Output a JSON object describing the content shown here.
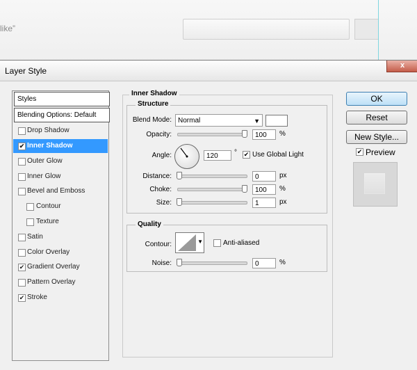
{
  "background_page": {
    "text": "like”"
  },
  "dialog": {
    "title": "Layer Style",
    "close_label": "x"
  },
  "styles_list": {
    "header": "Styles",
    "blending": "Blending Options: Default",
    "items": [
      {
        "label": "Drop Shadow",
        "checked": false
      },
      {
        "label": "Inner Shadow",
        "checked": true
      },
      {
        "label": "Outer Glow",
        "checked": false
      },
      {
        "label": "Inner Glow",
        "checked": false
      },
      {
        "label": "Bevel and Emboss",
        "checked": false
      },
      {
        "label": "Contour",
        "checked": false
      },
      {
        "label": "Texture",
        "checked": false
      },
      {
        "label": "Satin",
        "checked": false
      },
      {
        "label": "Color Overlay",
        "checked": false
      },
      {
        "label": "Gradient Overlay",
        "checked": true
      },
      {
        "label": "Pattern Overlay",
        "checked": false
      },
      {
        "label": "Stroke",
        "checked": true
      }
    ],
    "selected": "Inner Shadow"
  },
  "inner_shadow": {
    "title": "Inner Shadow",
    "structure": {
      "title": "Structure",
      "blend_mode_label": "Blend Mode:",
      "blend_mode_value": "Normal",
      "opacity_label": "Opacity:",
      "opacity_value": "100",
      "opacity_unit": "%",
      "angle_label": "Angle:",
      "angle_value": "120",
      "angle_unit": "°",
      "use_global_light_label": "Use Global Light",
      "use_global_light": true,
      "distance_label": "Distance:",
      "distance_value": "0",
      "distance_unit": "px",
      "choke_label": "Choke:",
      "choke_value": "100",
      "choke_unit": "%",
      "size_label": "Size:",
      "size_value": "1",
      "size_unit": "px"
    },
    "quality": {
      "title": "Quality",
      "contour_label": "Contour:",
      "anti_aliased_label": "Anti-aliased",
      "anti_aliased": false,
      "noise_label": "Noise:",
      "noise_value": "0",
      "noise_unit": "%"
    }
  },
  "buttons": {
    "ok": "OK",
    "reset": "Reset",
    "new_style": "New Style...",
    "preview_label": "Preview",
    "preview_checked": true
  },
  "colors": {
    "selection": "#3399ff",
    "shadow_color": "#ffffff"
  }
}
